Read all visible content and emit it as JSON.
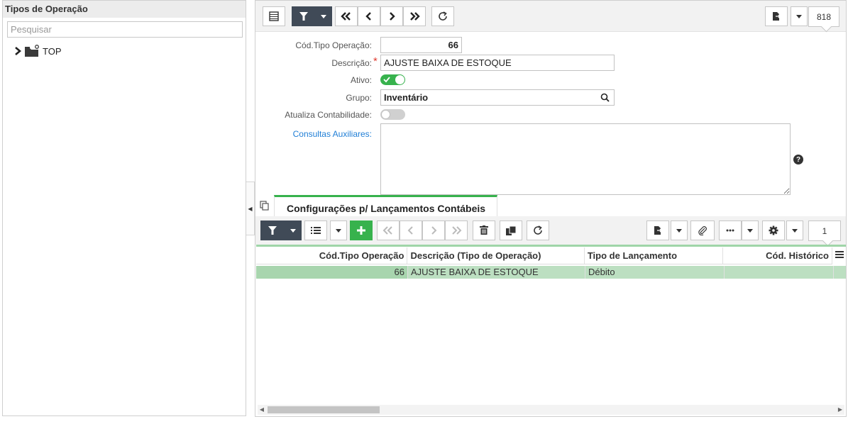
{
  "left": {
    "title": "Tipos de Operação",
    "search_placeholder": "Pesquisar",
    "tree_node": "TOP"
  },
  "top_toolbar": {
    "record_count": "818"
  },
  "form": {
    "cod_tipo_label": "Cód.Tipo Operação:",
    "cod_tipo_value": "66",
    "descricao_label": "Descrição:",
    "descricao_value": "AJUSTE BAIXA DE ESTOQUE",
    "ativo_label": "Ativo:",
    "ativo_on": true,
    "grupo_label": "Grupo:",
    "grupo_value": "Inventário",
    "contab_label": "Atualiza Contabilidade:",
    "contab_on": false,
    "consultas_label": "Consultas Auxiliares:"
  },
  "tabs": {
    "config": "Configurações p/ Lançamentos Contábeis"
  },
  "grid_toolbar": {
    "record_count": "1"
  },
  "grid": {
    "columns": [
      "Cód.Tipo Operação",
      "Descrição (Tipo de Operação)",
      "Tipo de Lançamento",
      "Cód. Histórico"
    ],
    "rows": [
      [
        "66",
        "AJUSTE BAIXA DE ESTOQUE",
        "Débito",
        ""
      ]
    ]
  },
  "colors": {
    "accent_green": "#37b24d",
    "dark_button": "#404a57",
    "link_blue": "#1f7ed6"
  }
}
